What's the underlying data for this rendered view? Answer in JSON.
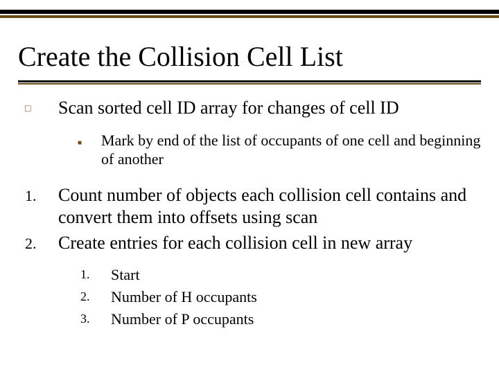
{
  "title": "Create the Collision Cell List",
  "bullets": {
    "b1": {
      "text": "Scan sorted cell ID array for changes of cell ID",
      "sub": {
        "s1": "Mark by end of the list of occupants of one cell and beginning of another"
      }
    }
  },
  "numbered": {
    "n1": {
      "index": "1.",
      "text": "Count number of objects each collision cell contains and convert them into offsets using scan"
    },
    "n2": {
      "index": "2.",
      "text": "Create entries for each collision cell in new array"
    }
  },
  "subnumbered": {
    "s1": {
      "index": "1.",
      "text": "Start"
    },
    "s2": {
      "index": "2.",
      "text": "Number of H occupants"
    },
    "s3": {
      "index": "3.",
      "text": "Number of P occupants"
    }
  },
  "glyphs": {
    "hollow_square": "□",
    "filled_square": "■"
  }
}
